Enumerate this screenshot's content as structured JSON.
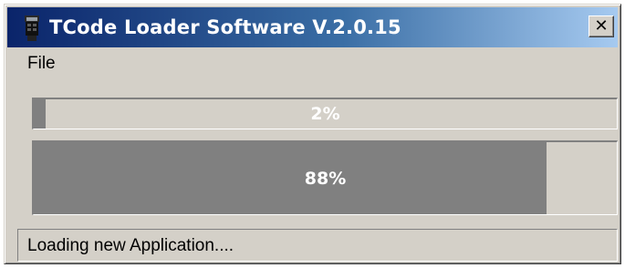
{
  "window": {
    "title": "TCode Loader Software V.2.0.15",
    "app_icon": "handheld-device-icon",
    "close_glyph": "✕",
    "close_icon": "close-icon"
  },
  "menu": {
    "items": [
      {
        "label": "File"
      }
    ]
  },
  "progress": {
    "top": {
      "label": "2%",
      "percent": 2
    },
    "bottom": {
      "label": "88%",
      "percent": 88
    }
  },
  "status": {
    "text": "Loading new Application...."
  },
  "colors": {
    "title_gradient_start": "#0a246a",
    "title_gradient_end": "#a6caf0",
    "progress_fill": "#808080",
    "face": "#d4d0c8"
  }
}
